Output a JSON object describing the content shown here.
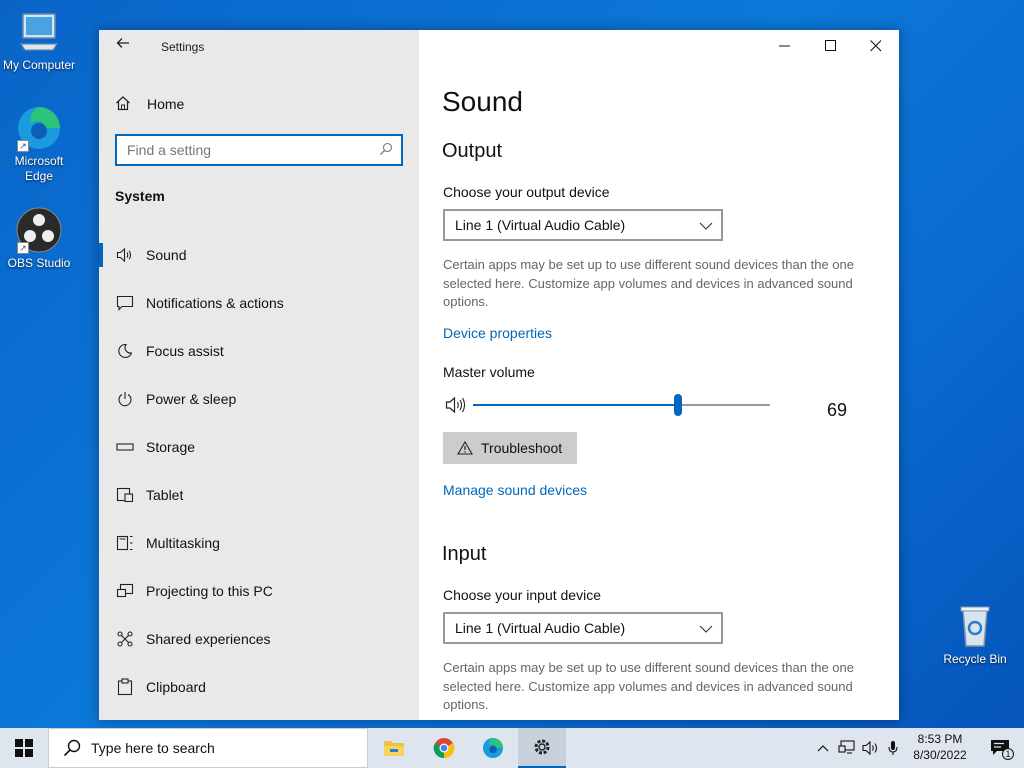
{
  "desktop": {
    "icons": [
      {
        "label": "My Computer"
      },
      {
        "label": "Microsoft Edge"
      },
      {
        "label": "OBS Studio"
      },
      {
        "label": "Recycle Bin"
      }
    ]
  },
  "window": {
    "title": "Settings",
    "sidebar": {
      "home_label": "Home",
      "search_placeholder": "Find a setting",
      "section": "System",
      "items": [
        {
          "label": "Sound",
          "icon": "speaker-icon",
          "active": true
        },
        {
          "label": "Notifications & actions",
          "icon": "notification-icon"
        },
        {
          "label": "Focus assist",
          "icon": "moon-icon"
        },
        {
          "label": "Power & sleep",
          "icon": "power-icon"
        },
        {
          "label": "Storage",
          "icon": "storage-icon"
        },
        {
          "label": "Tablet",
          "icon": "tablet-icon"
        },
        {
          "label": "Multitasking",
          "icon": "multitasking-icon"
        },
        {
          "label": "Projecting to this PC",
          "icon": "projecting-icon"
        },
        {
          "label": "Shared experiences",
          "icon": "shared-icon"
        },
        {
          "label": "Clipboard",
          "icon": "clipboard-icon"
        }
      ]
    },
    "main": {
      "page_title": "Sound",
      "output": {
        "heading": "Output",
        "device_label": "Choose your output device",
        "device_value": "Line 1 (Virtual Audio Cable)",
        "description": "Certain apps may be set up to use different sound devices than the one selected here. Customize app volumes and devices in advanced sound options.",
        "device_properties_link": "Device properties",
        "master_volume_label": "Master volume",
        "volume": 69,
        "volume_text": "69",
        "troubleshoot_label": "Troubleshoot",
        "manage_link": "Manage sound devices"
      },
      "input": {
        "heading": "Input",
        "device_label": "Choose your input device",
        "device_value": "Line 1 (Virtual Audio Cable)",
        "description": "Certain apps may be set up to use different sound devices than the one selected here. Customize app volumes and devices in advanced sound options."
      }
    }
  },
  "taskbar": {
    "search_placeholder": "Type here to search",
    "time": "8:53 PM",
    "date": "8/30/2022",
    "notification_count": "1"
  },
  "colors": {
    "accent": "#0067c0",
    "link": "#0067b8"
  }
}
